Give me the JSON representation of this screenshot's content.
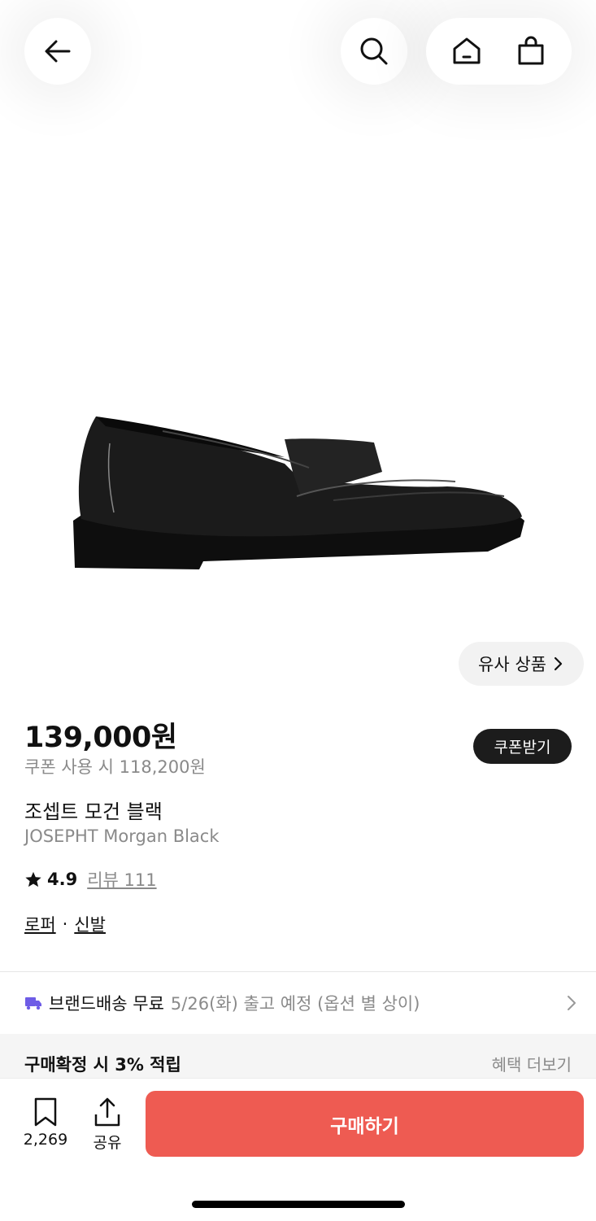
{
  "header": {
    "icons": [
      "back-arrow-icon",
      "search-icon",
      "home-icon",
      "shopping-bag-icon"
    ]
  },
  "product": {
    "similar_label": "유사 상품",
    "price": "139,000원",
    "coupon_price": "쿠폰 사용 시 118,200원",
    "coupon_button": "쿠폰받기",
    "name_ko": "조셉트 모건 블랙",
    "name_en": "JOSEPHT Morgan Black",
    "rating": "4.9",
    "review_label": "리뷰 111",
    "categories": [
      "로퍼",
      "신발"
    ]
  },
  "delivery": {
    "label": "브랜드배송 무료",
    "detail": "5/26(화) 출고 예정 (옵션 별 상이)"
  },
  "benefit": {
    "title": "구매확정 시 3% 적립",
    "more": "혜택 더보기"
  },
  "bottom_bar": {
    "save_count": "2,269",
    "share_label": "공유",
    "buy_label": "구매하기"
  },
  "colors": {
    "buy_button": "#ee5b52",
    "truck_icon": "#6e5ce6"
  }
}
